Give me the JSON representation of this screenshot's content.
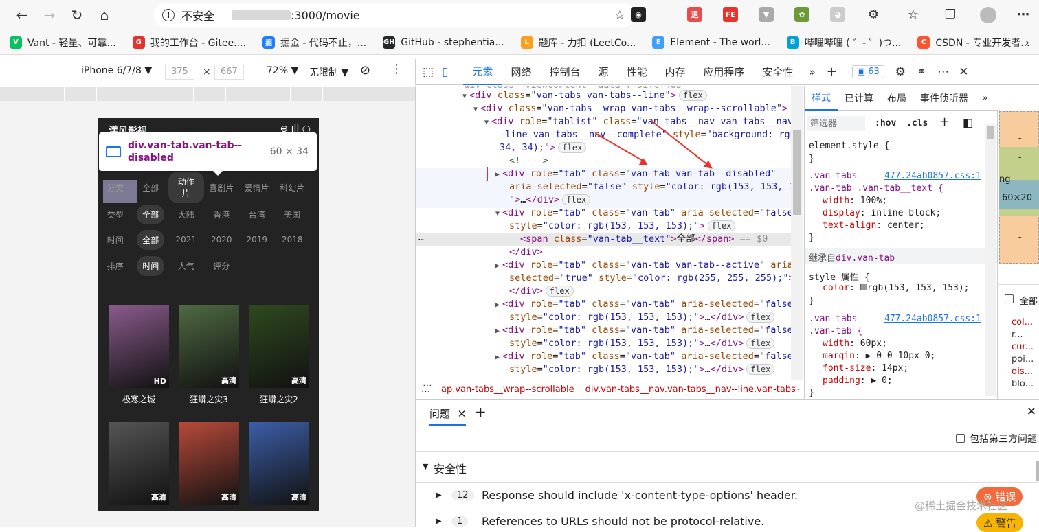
{
  "browser": {
    "url_security": "不安全",
    "url_path": ":3000/movie",
    "bookmarks": [
      {
        "label": "Vant - 轻量、可靠...",
        "color": "#07c160",
        "icon": "V"
      },
      {
        "label": "我的工作台 - Gitee....",
        "color": "#e5322f",
        "icon": "G"
      },
      {
        "label": "掘金 - 代码不止，...",
        "color": "#1e80ff",
        "icon": "掘"
      },
      {
        "label": "GitHub - stephentia...",
        "color": "#24292f",
        "icon": "GH"
      },
      {
        "label": "题库 - 力扣 (LeetCo...",
        "color": "#f89f1b",
        "icon": "L"
      },
      {
        "label": "Element - The worl...",
        "color": "#409eff",
        "icon": "E"
      },
      {
        "label": "哔哩哔哩 ( ゜- ゜)つ...",
        "color": "#00a1d6",
        "icon": "B"
      },
      {
        "label": "CSDN - 专业开发者...",
        "color": "#fc5531",
        "icon": "C"
      }
    ]
  },
  "device_toolbar": {
    "device": "iPhone 6/7/8 ▼",
    "width": "375",
    "x": "×",
    "height": "667",
    "zoom": "72% ▼",
    "throttle": "无限制 ▼"
  },
  "phone": {
    "app_name": "渼风影视",
    "rows": [
      {
        "items": [
          "分类",
          "全部",
          "动作片",
          "喜剧片",
          "爱情片",
          "科幻片"
        ],
        "pill": 2
      },
      {
        "items": [
          "类型",
          "全部",
          "大陆",
          "香港",
          "台湾",
          "美国"
        ],
        "pill": 1
      },
      {
        "items": [
          "时间",
          "全部",
          "2021",
          "2020",
          "2019",
          "2018"
        ],
        "pill": 1
      },
      {
        "items": [
          "排序",
          "时间",
          "人气",
          "评分"
        ],
        "pill": 1
      }
    ],
    "movies": [
      {
        "title": "极寒之城",
        "badge": "HD",
        "color": "#8a5b8c"
      },
      {
        "title": "狂蟒之灾3",
        "badge": "高清",
        "color": "#4f6a42"
      },
      {
        "title": "狂蟒之灾2",
        "badge": "高清",
        "color": "#2f4a1f"
      },
      {
        "title": "",
        "badge": "高清",
        "color": "#555"
      },
      {
        "title": "",
        "badge": "高清",
        "color": "#b84a3a"
      },
      {
        "title": "",
        "badge": "高清",
        "color": "#3c5ea8"
      }
    ]
  },
  "tooltip": {
    "selector": "div.van-tab.van-tab--disabled",
    "size": "60 × 34"
  },
  "devtools": {
    "tabs": [
      "元素",
      "网络",
      "控制台",
      "源",
      "性能",
      "内存",
      "应用程序",
      "安全性"
    ],
    "active_tab": 0,
    "issues_count": "63",
    "dom_lines": [
      {
        "indent": 0,
        "html": "<span class='tag'>&lt;div</span> <span class='an'>class</span>=<span class='av'>\"van-tabs van-tabs--line\"</span><span class='tag'>&gt;</span>",
        "tri": "▼",
        "flex": true
      },
      {
        "indent": 1,
        "html": "<span class='tag'>&lt;div</span> <span class='an'>class</span>=<span class='av'>\"van-tabs__wrap van-tabs__wrap--scrollable\"</span><span class='tag'>&gt;</span>",
        "tri": "▼",
        "flex": false
      },
      {
        "indent": 2,
        "html": "<span class='tag'>&lt;div</span> <span class='an'>role</span>=<span class='av'>\"tablist\"</span> <span class='an'>class</span>=<span class='av'>\"van-tabs__nav van-tabs__nav-</span>",
        "tri": "▼",
        "flex": false
      },
      {
        "indent": 2,
        "html": "<span class='av'>-line van-tabs__nav--complete\"</span> <span class='an'>style</span>=<span class='av'>\"background: rgb(34,</span>",
        "tri": "",
        "flex": false
      },
      {
        "indent": 2,
        "html": "<span class='av'>34, 34);\"</span><span class='tag'>&gt;</span>",
        "tri": "",
        "flex": true
      },
      {
        "indent": 3,
        "html": "<span class='cm'>&lt;!----&gt;</span>",
        "tri": "",
        "flex": false
      },
      {
        "indent": 3,
        "html": "<span class='tag'>&lt;div</span> <span class='an'>role</span>=<span class='av'>\"tab\"</span> <span class='an'>class</span>=<span class='av'>\"van-tab van-tab--disabled\"</span>",
        "tri": "▶",
        "flex": false
      },
      {
        "indent": 3,
        "html": "<span class='an'>aria-selected</span>=<span class='av'>\"false\"</span> <span class='an'>style</span>=<span class='av'>\"color: rgb(153, 153, 153);</span>",
        "tri": "",
        "flex": false
      },
      {
        "indent": 3,
        "html": "<span class='av'>\"</span><span class='tag'>&gt;</span>…<span class='tag'>&lt;/div&gt;</span>",
        "tri": "",
        "flex": true
      },
      {
        "indent": 3,
        "html": "<span class='tag'>&lt;div</span> <span class='an'>role</span>=<span class='av'>\"tab\"</span> <span class='an'>class</span>=<span class='av'>\"van-tab\"</span> <span class='an'>aria-selected</span>=<span class='av'>\"false\"</span>",
        "tri": "▼",
        "flex": false
      },
      {
        "indent": 3,
        "html": "<span class='an'>style</span>=<span class='av'>\"color: rgb(153, 153, 153);\"</span><span class='tag'>&gt;</span>",
        "tri": "",
        "flex": true
      },
      {
        "indent": 4,
        "html": "<span class='tag'>&lt;span</span> <span class='an'>class</span>=<span class='av'>\"van-tab__text\"</span><span class='tag'>&gt;</span>全部<span class='tag'>&lt;/span&gt;</span> <span style='color:#888'>== $0</span>",
        "tri": "",
        "flex": false
      },
      {
        "indent": 3,
        "html": "<span class='tag'>&lt;/div&gt;</span>",
        "tri": "",
        "flex": false
      },
      {
        "indent": 3,
        "html": "<span class='tag'>&lt;div</span> <span class='an'>role</span>=<span class='av'>\"tab\"</span> <span class='an'>class</span>=<span class='av'>\"van-tab van-tab--active\"</span> <span class='an'>aria-</span>",
        "tri": "▶",
        "flex": false
      },
      {
        "indent": 3,
        "html": "<span class='an'>selected</span>=<span class='av'>\"true\"</span> <span class='an'>style</span>=<span class='av'>\"color: rgb(255, 255, 255);\"</span><span class='tag'>&gt;</span>…",
        "tri": "",
        "flex": false
      },
      {
        "indent": 3,
        "html": "<span class='tag'>&lt;/div&gt;</span>",
        "tri": "",
        "flex": true
      },
      {
        "indent": 3,
        "html": "<span class='tag'>&lt;div</span> <span class='an'>role</span>=<span class='av'>\"tab\"</span> <span class='an'>class</span>=<span class='av'>\"van-tab\"</span> <span class='an'>aria-selected</span>=<span class='av'>\"false\"</span>",
        "tri": "▶",
        "flex": false
      },
      {
        "indent": 3,
        "html": "<span class='an'>style</span>=<span class='av'>\"color: rgb(153, 153, 153);\"</span><span class='tag'>&gt;</span>…<span class='tag'>&lt;/div&gt;</span>",
        "tri": "",
        "flex": true
      },
      {
        "indent": 3,
        "html": "<span class='tag'>&lt;div</span> <span class='an'>role</span>=<span class='av'>\"tab\"</span> <span class='an'>class</span>=<span class='av'>\"van-tab\"</span> <span class='an'>aria-selected</span>=<span class='av'>\"false\"</span>",
        "tri": "▶",
        "flex": false
      },
      {
        "indent": 3,
        "html": "<span class='an'>style</span>=<span class='av'>\"color: rgb(153, 153, 153);\"</span><span class='tag'>&gt;</span>…<span class='tag'>&lt;/div&gt;</span>",
        "tri": "",
        "flex": true
      },
      {
        "indent": 3,
        "html": "<span class='tag'>&lt;div</span> <span class='an'>role</span>=<span class='av'>\"tab\"</span> <span class='an'>class</span>=<span class='av'>\"van-tab\"</span> <span class='an'>aria-selected</span>=<span class='av'>\"false\"</span>",
        "tri": "▶",
        "flex": false
      },
      {
        "indent": 3,
        "html": "<span class='an'>style</span>=<span class='av'>\"color: rgb(153, 153, 153);\"</span><span class='tag'>&gt;</span>…<span class='tag'>&lt;/div&gt;</span>",
        "tri": "",
        "flex": true
      }
    ],
    "breadcrumb": [
      "…",
      "ap.van-tabs__wrap--scrollable",
      "div.van-tabs__nav.van-tabs__nav--line.van-tabs"
    ],
    "styles": {
      "tabs": [
        "样式",
        "已计算",
        "布局",
        "事件侦听器"
      ],
      "filter_placeholder": "筛选器",
      "hov": ":hov",
      "cls": ".cls",
      "element_style": "element.style {",
      "close": "}",
      "rule1_selector1": ".van-tabs",
      "rule1_selector2": ".van-tab .van-tab__text {",
      "rule1_link": "477.24ab0857.css:1",
      "rule1_props": [
        [
          "width",
          "100%;"
        ],
        [
          "display",
          "inline-block;"
        ],
        [
          "text-align",
          "center;"
        ]
      ],
      "inherited_label": "继承自",
      "inherited_from": "div.van-tab",
      "style_attr": "style 属性 {",
      "style_color": "rgb(153, 153, 153);",
      "rule2_selector1": ".van-tabs",
      "rule2_selector2": ".van-tab {",
      "rule2_link": "477.24ab0857.css:1",
      "rule2_props": [
        [
          "width",
          "60px;"
        ],
        [
          "margin",
          "▶ 0 0 10px 0;"
        ],
        [
          "font-size",
          "14px;"
        ],
        [
          "padding",
          "▶ 0;"
        ]
      ]
    },
    "boxmodel": {
      "size": "60×20",
      "ng": "ng",
      "dash": "-",
      "all_label": "全部",
      "props": [
        "col...",
        "r...",
        "cur...",
        "poi...",
        "dis...",
        "blo..."
      ]
    },
    "drawer": {
      "tab": "问题",
      "third_party": "包括第三方问题",
      "section": "安全性",
      "issues": [
        {
          "count": "12",
          "text": "Response should include 'x-content-type-options' header."
        },
        {
          "count": "1",
          "text": "References to URLs should not be protocol-relative."
        }
      ],
      "error_btn": "⊗ 错误",
      "warn_btn": "⚠ 警告"
    }
  },
  "watermark": "@稀土掘金技术社区"
}
